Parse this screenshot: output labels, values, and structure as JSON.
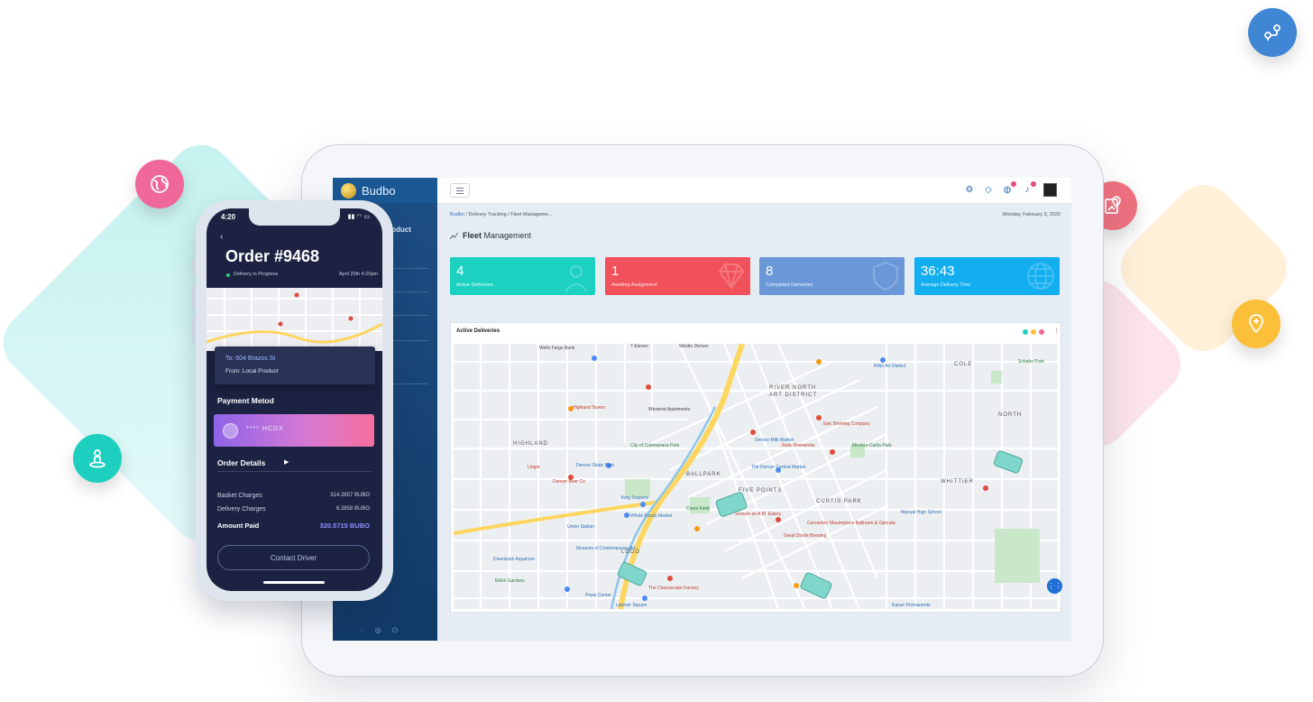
{
  "colors": {
    "teal": "#1dd1c1",
    "red": "#f1515a",
    "blue": "#6a97d8",
    "sky": "#12aef0",
    "accent_blue": "#2f6fc0"
  },
  "floating_icons": [
    "route-pin-icon",
    "globe-icon",
    "map-pin-icon",
    "add-location-icon",
    "person-location-icon"
  ],
  "dashboard": {
    "brand": "Budbo",
    "breadcrumb": [
      "Budbo",
      "Delivery Tracking",
      "Fleet Manageme..."
    ],
    "breadcrumb_sep": "/",
    "date": "Monday, February 3, 2020",
    "page_title_bold": "Fleet",
    "page_title_rest": " Management",
    "sidebar_fragment": "roduct",
    "stats": [
      {
        "value": "4",
        "label": "Active Deliveries"
      },
      {
        "value": "1",
        "label": "Awaiting Assignment"
      },
      {
        "value": "8",
        "label": "Completed Deliveries"
      },
      {
        "value": "36:43",
        "label": "Average Delivery Time"
      }
    ],
    "panel_title": "Active Deliveries",
    "map_labels": [
      "Wells Fargo Bank",
      "7-Eleven",
      "Westin Denver",
      "RiNo Art District",
      "RIVER NORTH",
      "ART DISTRICT",
      "COLE",
      "Schafer Park",
      "Westend Apartments",
      "HIGHLAND",
      "Highland Tavern",
      "BALLPARK",
      "FIVE POINTS",
      "CURTIS PARK",
      "WHITTIER",
      "NORTH",
      "City of Cuernavaca Park",
      "Denver Skate Park",
      "Coors Field",
      "King Soopers",
      "Whole Foods Market",
      "LODO",
      "Union Station",
      "Museum of Contemporary Art",
      "Downtown Aquarium",
      "Elitch Gardens",
      "Pepsi Center",
      "Larimer Square",
      "Manual High School",
      "Kaiser Permanente",
      "Great Divide Brewing",
      "Denver Milk Market",
      "Epic Brewing Company",
      "Ratio Beerworks",
      "The Denver Central Market",
      "Mestizo-Curtis Park",
      "Cervantes' Masterpiece Ballroom & Operatic",
      "Snooze an A.M. Eatery",
      "The Cheesecake Factory",
      "Linger",
      "Denver Beer Co"
    ]
  },
  "phone": {
    "time": "4:20",
    "order_title": "Order #9468",
    "status": "Delivery in Progress",
    "date": "April 20th 4:20pm",
    "to": "To: 604 Brazos St",
    "from": "From: Local Product",
    "payment_title": "Payment Metod",
    "card_number": "****  HCDX",
    "order_details": "Order Details",
    "rows": [
      {
        "label": "Basket Charges",
        "value": "314.2857 BUBO"
      },
      {
        "label": "Delivery Charges",
        "value": "6.2858 BUBO"
      }
    ],
    "amount_label": "Amount Paid",
    "amount_value": "320.5715 BUBO",
    "contact_button": "Contact Driver"
  }
}
